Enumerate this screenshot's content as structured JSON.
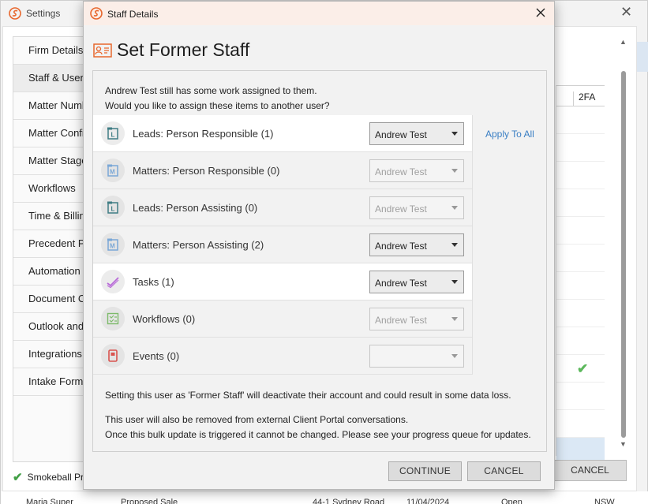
{
  "bg": {
    "title": "Settings",
    "nav": [
      "Firm Details",
      "Staff & Users",
      "Matter Numbering",
      "Matter Configuration",
      "Matter Stages",
      "Workflows",
      "Time & Billing",
      "Precedent Preferences",
      "Automation",
      "Document Comparison",
      "Outlook and Email",
      "Integrations",
      "Intake Forms"
    ],
    "table_header": "2FA",
    "status": "Smokeball Pro",
    "cancel_label": "CANCEL",
    "bottom_row": [
      "Maria Super",
      "Proposed Sale",
      "44-1 Sydney Road",
      "11/04/2024",
      "Open",
      "NSW"
    ]
  },
  "dialog": {
    "title": "Staff Details",
    "heading": "Set Former Staff",
    "intro_line1": "Andrew Test still has some work assigned to them.",
    "intro_line2": "Would you like to assign these items to another user?",
    "apply_all": "Apply To All",
    "rows": [
      {
        "label": "Leads: Person Responsible (1)",
        "value": "Andrew Test",
        "icon": "lead-icon",
        "enabled": true
      },
      {
        "label": "Matters: Person Responsible (0)",
        "value": "Andrew Test",
        "icon": "matter-icon",
        "enabled": false
      },
      {
        "label": "Leads: Person Assisting (0)",
        "value": "Andrew Test",
        "icon": "lead-icon",
        "enabled": false
      },
      {
        "label": "Matters: Person Assisting (2)",
        "value": "Andrew Test",
        "icon": "matter-icon",
        "enabled": true
      },
      {
        "label": "Tasks (1)",
        "value": "Andrew Test",
        "icon": "task-icon",
        "enabled": true
      },
      {
        "label": "Workflows (0)",
        "value": "Andrew Test",
        "icon": "workflow-icon",
        "enabled": false
      },
      {
        "label": "Events (0)",
        "value": "",
        "icon": "event-icon",
        "enabled": false
      }
    ],
    "note1": "Setting this user as 'Former Staff' will deactivate their account and could result in some data loss.",
    "note2": "This user will also be removed from external Client Portal conversations.",
    "note3": "Once this bulk update is triggered it cannot be changed. Please see your progress queue for updates.",
    "continue_label": "CONTINUE",
    "cancel_label": "CANCEL"
  },
  "colors": {
    "brand": "#e8672d",
    "link": "#3a7fc4",
    "lead": "#3f7d84",
    "matter": "#7aa7d6",
    "task": "#b86ad8",
    "workflow": "#7dba6a",
    "event": "#d9534f"
  }
}
